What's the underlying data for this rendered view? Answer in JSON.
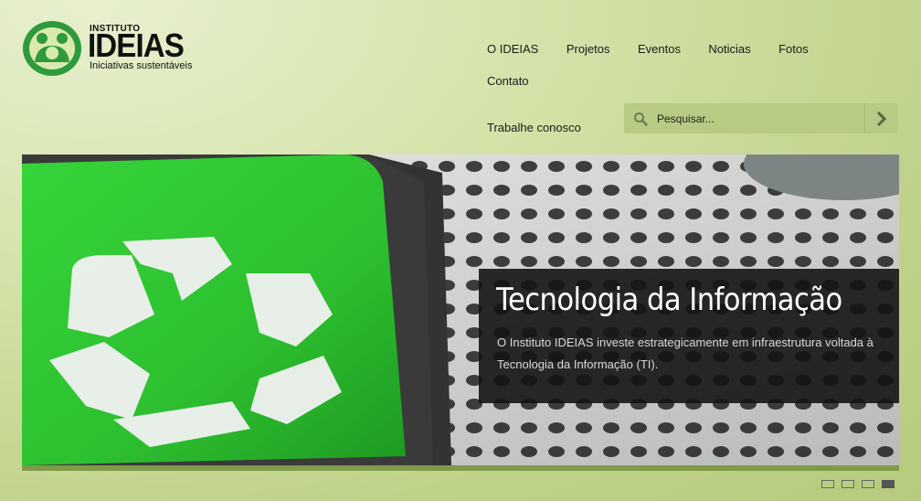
{
  "logo": {
    "top": "INSTITUTO",
    "name": "IDEIAS",
    "tagline": "Iniciativas sustentáveis"
  },
  "nav": {
    "items": [
      "O IDEIAS",
      "Projetos",
      "Eventos",
      "Noticias",
      "Fotos",
      "Contato"
    ],
    "second_row": "Trabalhe conosco"
  },
  "search": {
    "placeholder": "Pesquisar..."
  },
  "slide": {
    "title": "Tecnologia da Informação",
    "text": "O Instituto IDEIAS investe estrategicamente em infraestrutura voltada à Tecnologia da Informação (TI)."
  },
  "pager": {
    "count": 4,
    "active_index": 3
  },
  "colors": {
    "brand_green": "#2f9a3c",
    "accent_light_green": "#b6cb7d",
    "caption_bg": "#141414"
  }
}
